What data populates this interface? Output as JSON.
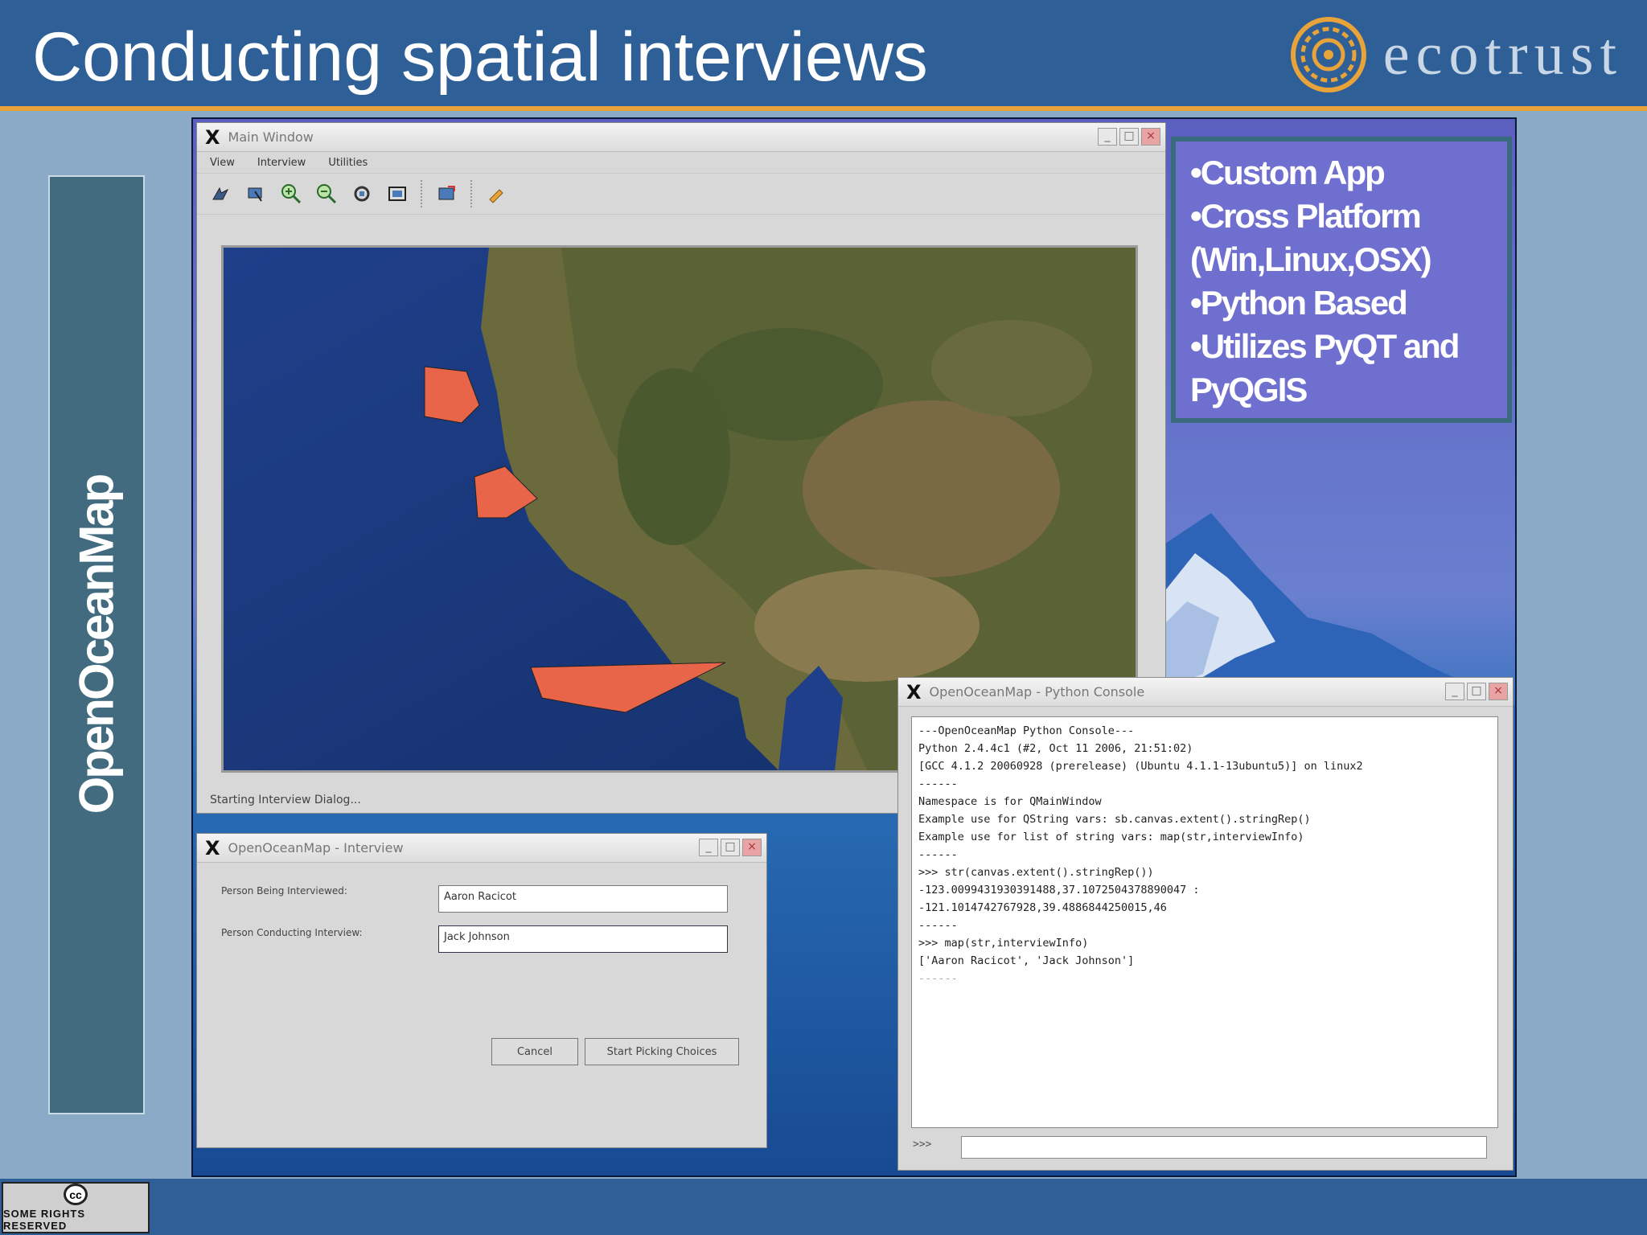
{
  "slide": {
    "title": "Conducting spatial interviews",
    "logo_text": "ecotrust",
    "side_label": "OpenOceanMap",
    "cc_badge_text": "SOME RIGHTS RESERVED",
    "accent_color": "#e8a33a",
    "header_color": "#2e5f96"
  },
  "bullets": [
    "•Custom App",
    "•Cross Platform",
    "(Win,Linux,OSX)",
    "•Python Based",
    "•Utilizes PyQT and",
    "PyQGIS"
  ],
  "main_window": {
    "title": "Main Window",
    "menu": [
      "View",
      "Interview",
      "Utilities"
    ],
    "toolbar_icons": [
      "pan-icon",
      "select-icon",
      "zoom-in-icon",
      "zoom-out-icon",
      "refresh-icon",
      "full-extent-icon",
      "draw-shape-icon",
      "edit-icon"
    ],
    "status": "Starting Interview Dialog..."
  },
  "interview_window": {
    "title": "OpenOceanMap - Interview",
    "fields": [
      {
        "label": "Person Being Interviewed:",
        "value": "Aaron Racicot"
      },
      {
        "label": "Person Conducting Interview:",
        "value": "Jack Johnson"
      }
    ],
    "cancel_label": "Cancel",
    "start_label": "Start Picking Choices"
  },
  "console_window": {
    "title": "OpenOceanMap - Python Console",
    "lines": [
      "---OpenOceanMap Python Console---",
      "Python 2.4.4c1 (#2, Oct 11 2006, 21:51:02)",
      "[GCC 4.1.2 20060928 (prerelease) (Ubuntu 4.1.1-13ubuntu5)] on linux2",
      "",
      "------",
      "Namespace is for QMainWindow",
      "Example use for QString vars: sb.canvas.extent().stringRep()",
      "Example use for list of string vars: map(str,interviewInfo)",
      "------",
      ">>> str(canvas.extent().stringRep())",
      "-123.0099431930391488,37.1072504378890047 :",
      "-121.1014742767928,39.4886844250015,46",
      "------",
      ">>> map(str,interviewInfo)",
      "['Aaron Racicot', 'Jack Johnson']",
      "------"
    ],
    "prompt": ">>>"
  }
}
